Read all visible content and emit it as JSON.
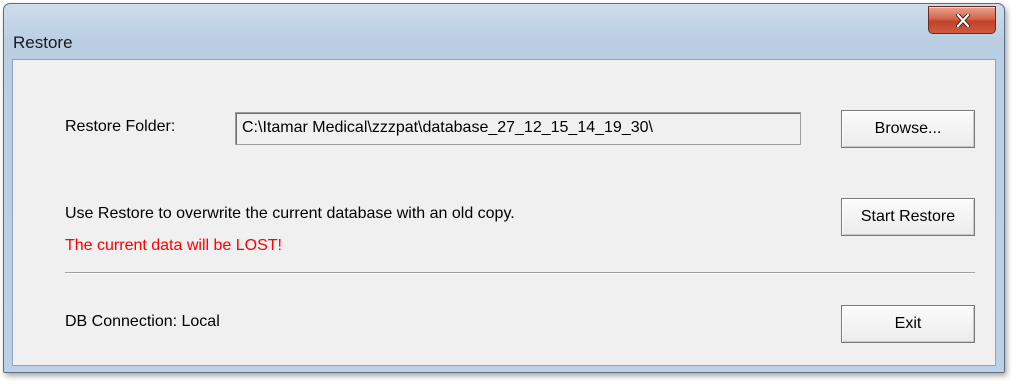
{
  "window": {
    "title": "Restore"
  },
  "restore_folder": {
    "label": "Restore Folder:",
    "value": "C:\\Itamar Medical\\zzzpat\\database_27_12_15_14_19_30\\"
  },
  "buttons": {
    "browse": "Browse...",
    "start_restore": "Start Restore",
    "exit": "Exit"
  },
  "message": {
    "info": "Use Restore to overwrite the current database with an old copy.",
    "warning": "The current data will be LOST!"
  },
  "db_connection": "DB Connection: Local",
  "colors": {
    "warning": "#ff0000",
    "close_button": "#c2412a"
  },
  "icons": {
    "close": "close-icon"
  }
}
